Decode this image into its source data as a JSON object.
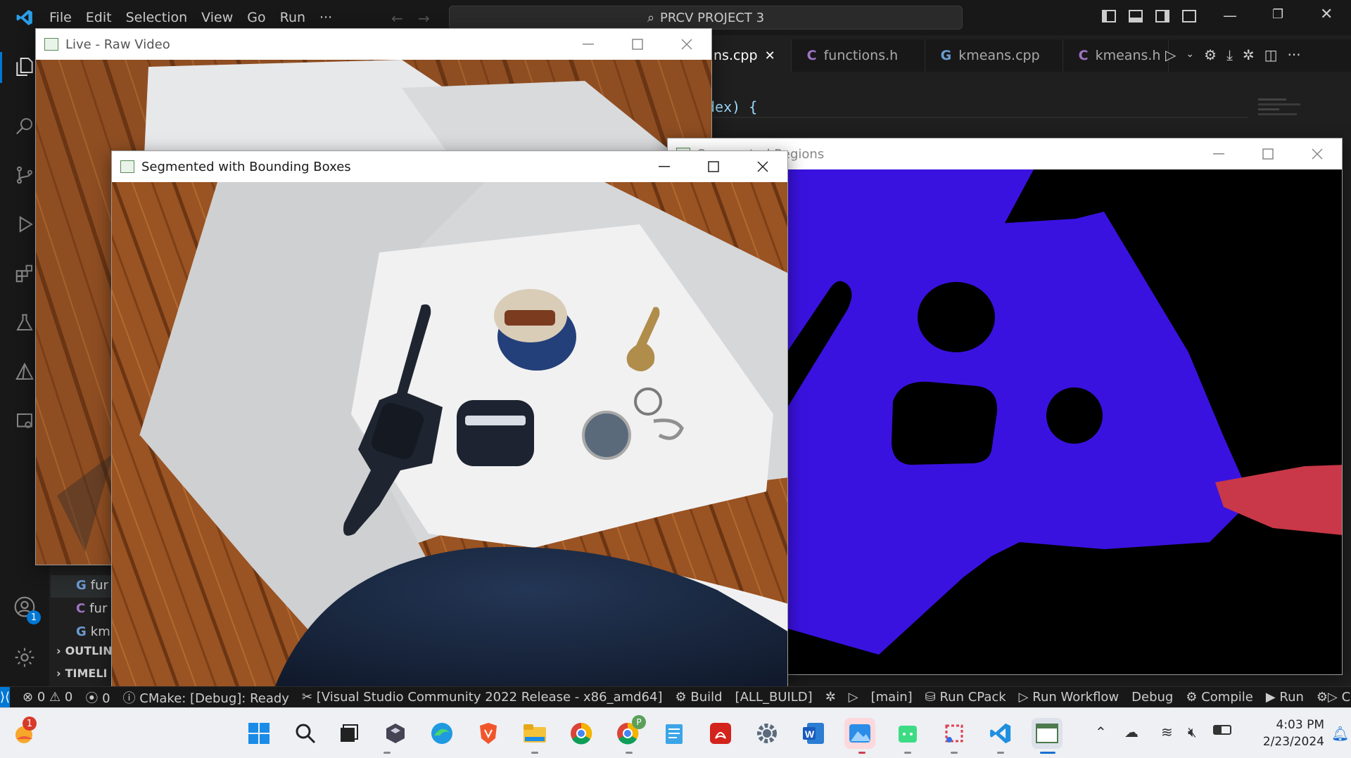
{
  "vscode": {
    "menu": [
      "File",
      "Edit",
      "Selection",
      "View",
      "Go",
      "Run",
      "···"
    ],
    "search_title": "PRCV PROJECT 3",
    "tabs": [
      {
        "label": "ns.cpp",
        "kind": "cpp",
        "active": true
      },
      {
        "label": "functions.h",
        "kind": "c",
        "active": false
      },
      {
        "label": "kmeans.cpp",
        "kind": "cpp",
        "active": false
      },
      {
        "label": "kmeans.h",
        "kind": "c",
        "active": false
      }
    ],
    "code_fragment": "dex) {",
    "sidebar": {
      "files": [
        "fur",
        "fur",
        "km"
      ],
      "sections": [
        "OUTLIN",
        "TIMELI"
      ]
    },
    "accounts_badge": "1",
    "status": {
      "errors": "0",
      "warnings": "0",
      "ports": "0",
      "cmake": "CMake: [Debug]: Ready",
      "kit": "[Visual Studio Community 2022 Release - x86_amd64]",
      "build": "Build",
      "target": "[ALL_BUILD]",
      "branch": "[main]",
      "cpack": "Run CPack",
      "workflow": "Run Workflow",
      "debug": "Debug",
      "compile": "Compile",
      "run": "Run",
      "more": "Co"
    }
  },
  "windows": {
    "raw": {
      "title": "Live - Raw Video"
    },
    "segmented_boxes": {
      "title": "Segmented with Bounding Boxes"
    },
    "regions": {
      "title": "Segmented Regions"
    }
  },
  "colors": {
    "region_blue": "#3a12e0",
    "region_red": "#c83848",
    "floor": "#8a4a20",
    "vscode_accent": "#0078d4"
  },
  "taskbar": {
    "weather_badge": "1",
    "chrome_profile": "P",
    "time": "4:03 PM",
    "date": "2/23/2024"
  }
}
